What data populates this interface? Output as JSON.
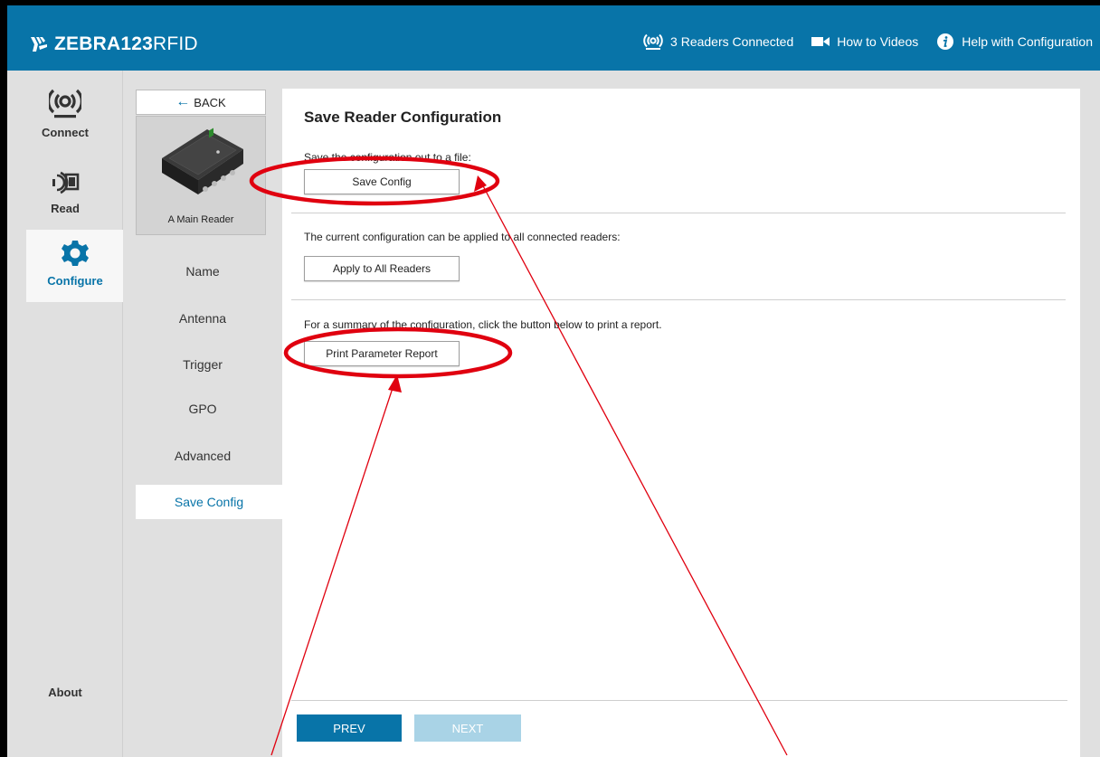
{
  "header": {
    "brand": "ZEBRA",
    "product_bold": " 123",
    "product_light": "RFID",
    "links": [
      {
        "icon": "readers-icon",
        "label": "3 Readers Connected"
      },
      {
        "icon": "video-camera-icon",
        "label": "How to Videos"
      },
      {
        "icon": "info-icon",
        "label": "Help with Configuration"
      }
    ]
  },
  "leftnav": {
    "connect": "Connect",
    "read": "Read",
    "configure": "Configure",
    "about": "About"
  },
  "subnav": {
    "back": "BACK",
    "reader_name": "A Main Reader",
    "items": [
      "Name",
      "Antenna",
      "Trigger",
      "GPO",
      "Advanced"
    ],
    "active_item": "Save Config"
  },
  "main": {
    "title": "Save Reader Configuration",
    "sections": [
      {
        "desc": "Save the configuration out to a file:",
        "button": "Save Config"
      },
      {
        "desc": "The current configuration can be applied to all connected readers:",
        "button": "Apply to All Readers"
      },
      {
        "desc": "For a summary of the configuration, click the button below to print a report.",
        "button": "Print Parameter Report"
      }
    ],
    "prev": "PREV",
    "next": "NEXT"
  },
  "colors": {
    "brand_blue": "#0874a8",
    "annotation_red": "#e0000f",
    "disabled_blue": "#a9d3e6"
  }
}
